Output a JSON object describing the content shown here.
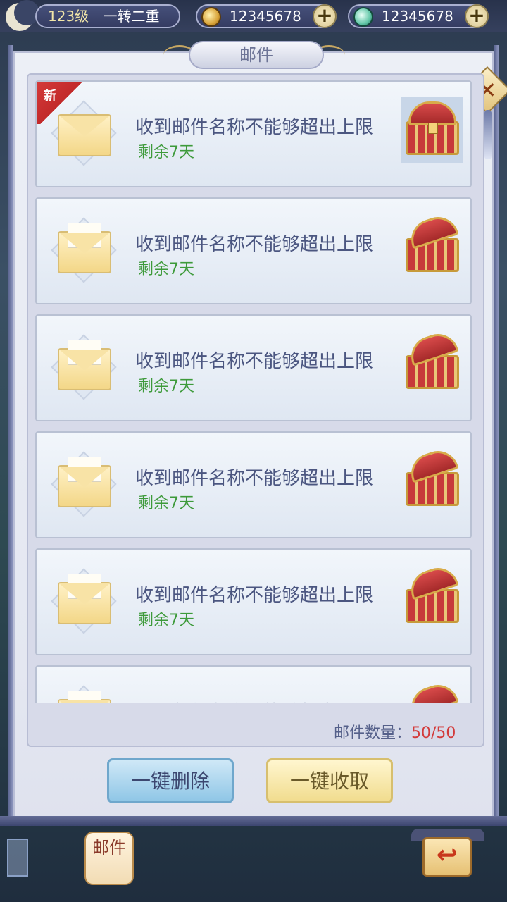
{
  "topbar": {
    "level": "123级",
    "realm": "一转二重",
    "gold_amount": "12345678",
    "jade_amount": "12345678",
    "plus_symbol": "+"
  },
  "panel": {
    "title": "邮件",
    "close_symbol": "✕"
  },
  "mails": [
    {
      "name": "收到邮件名称不能够超出上限",
      "days": "剩余7天",
      "is_new": true,
      "new_label": "新",
      "read": false
    },
    {
      "name": "收到邮件名称不能够超出上限",
      "days": "剩余7天",
      "is_new": false,
      "read": true
    },
    {
      "name": "收到邮件名称不能够超出上限",
      "days": "剩余7天",
      "is_new": false,
      "read": true
    },
    {
      "name": "收到邮件名称不能够超出上限",
      "days": "剩余7天",
      "is_new": false,
      "read": true
    },
    {
      "name": "收到邮件名称不能够超出上限",
      "days": "剩余7天",
      "is_new": false,
      "read": true
    },
    {
      "name": "收到邮件名称不能够超出上限",
      "days": "",
      "is_new": false,
      "read": true
    }
  ],
  "footer": {
    "count_label": "邮件数量：",
    "count_value": "50/50",
    "delete_all": "一键删除",
    "collect_all": "一键收取"
  },
  "bottom": {
    "mail_lantern": "邮件",
    "back_symbol": "↩"
  },
  "colors": {
    "days_green": "#3d9a3a",
    "count_red": "#d33a3a",
    "title_text": "#4b5680"
  }
}
